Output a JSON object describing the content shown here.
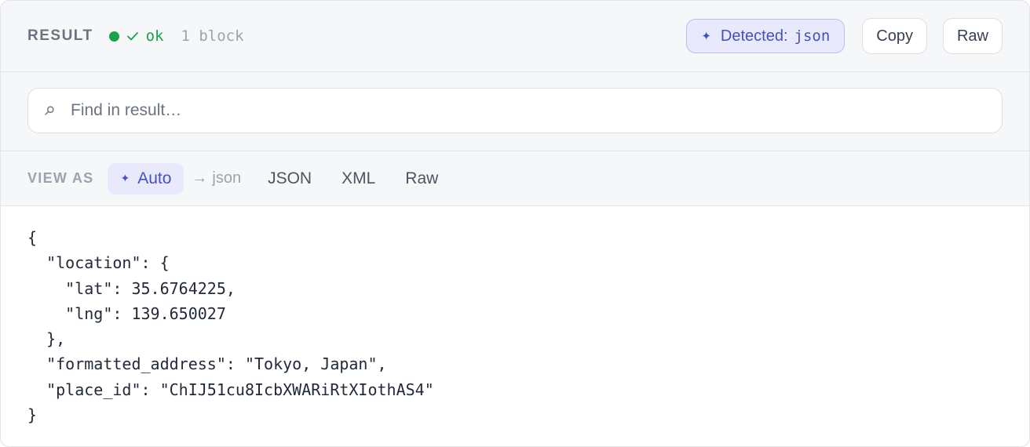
{
  "header": {
    "title": "RESULT",
    "status_text": "ok",
    "block_count": "1 block",
    "detected_label": "Detected:",
    "detected_value": "json",
    "copy_label": "Copy",
    "raw_label": "Raw"
  },
  "search": {
    "placeholder": "Find in result…"
  },
  "view_as": {
    "label": "VIEW AS",
    "active_tab": "Auto",
    "auto_hint": "json",
    "tabs": [
      "JSON",
      "XML",
      "Raw"
    ]
  },
  "code": {
    "lines": [
      "{",
      "  \"location\": {",
      "    \"lat\": 35.6764225,",
      "    \"lng\": 139.650027",
      "  },",
      "  \"formatted_address\": \"Tokyo, Japan\",",
      "  \"place_id\": \"ChIJ51cu8IcbXWARiRtXIothAS4\"",
      "}"
    ]
  },
  "colors": {
    "accent": "#4450c4",
    "accent_bg": "#e8eafc",
    "success": "#16a34a"
  },
  "icons": {
    "status": "check-icon",
    "detected": "sparkle-icon",
    "search": "search-icon",
    "hint": "arrow-right-icon"
  }
}
